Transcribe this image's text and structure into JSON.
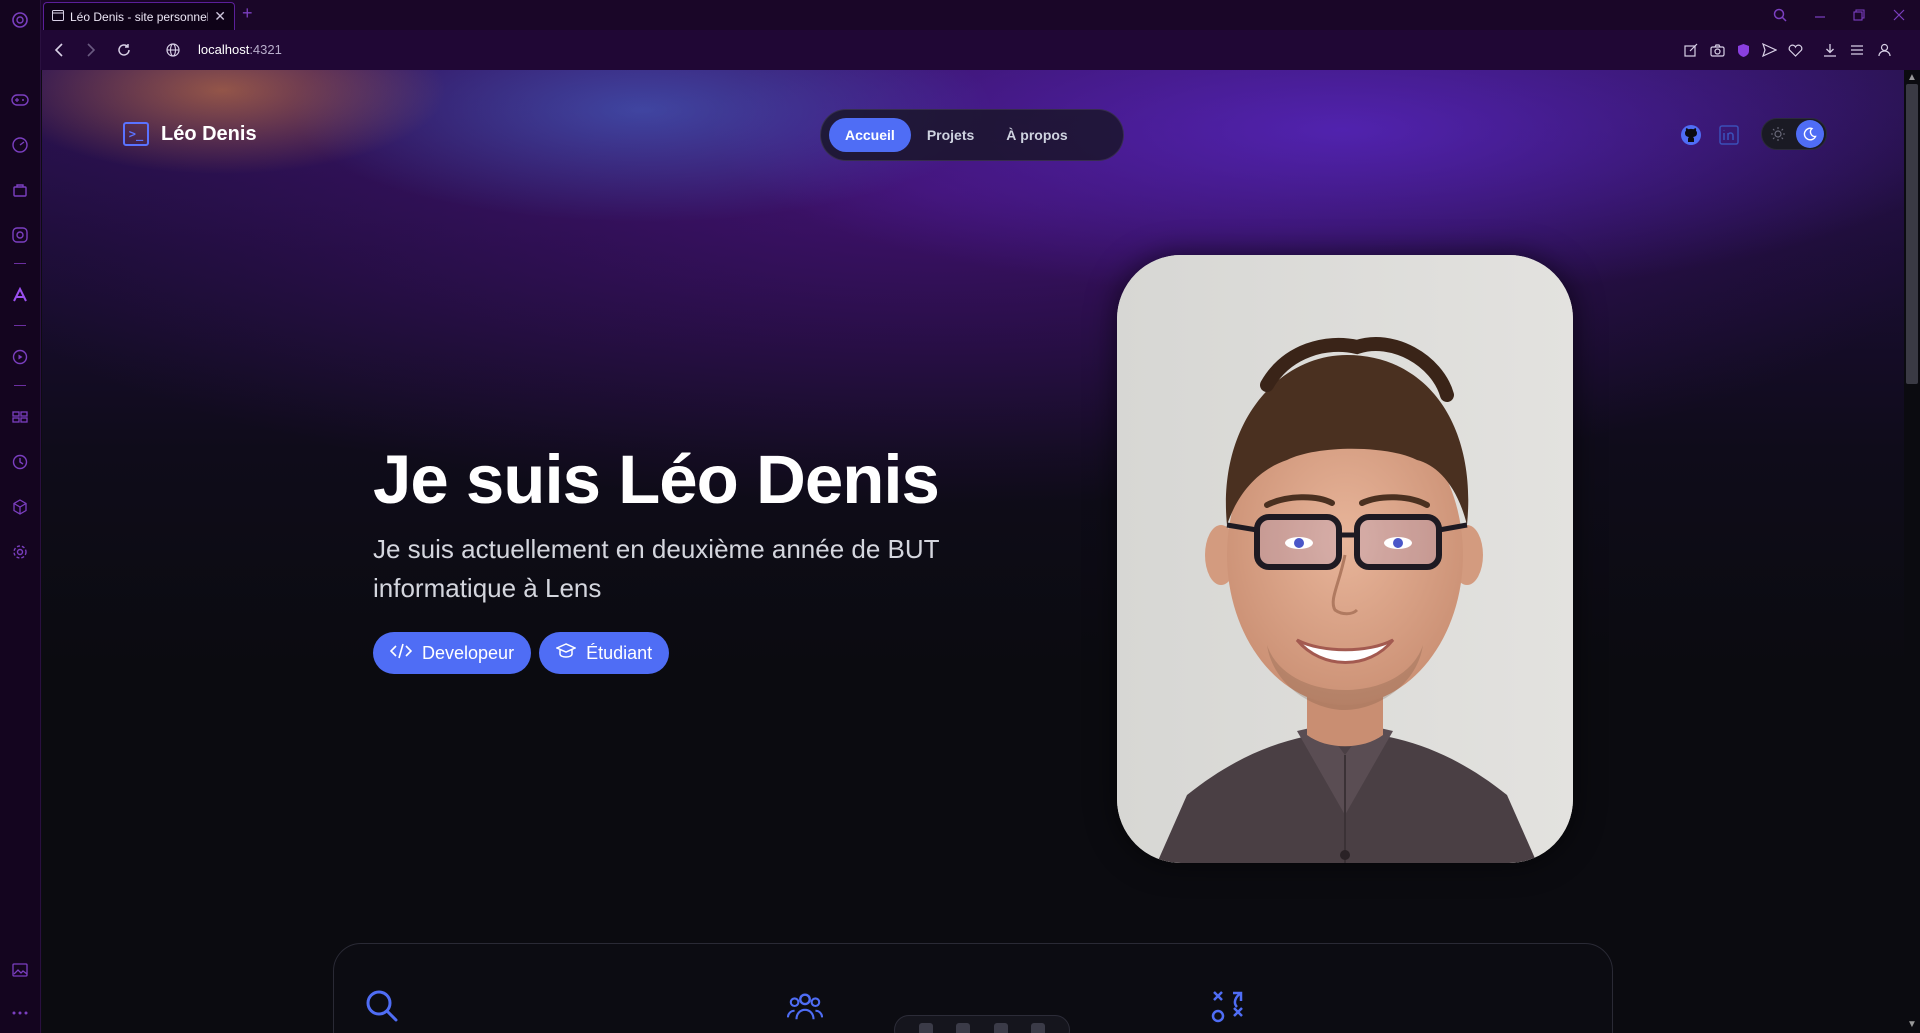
{
  "browser": {
    "tab_title": "Léo Denis - site personnel",
    "new_tab": "+",
    "url_host": "localhost",
    "url_port": ":4321"
  },
  "site": {
    "brand": "Léo Denis",
    "nav": [
      {
        "label": "Accueil",
        "active": true
      },
      {
        "label": "Projets",
        "active": false
      },
      {
        "label": "À propos",
        "active": false
      }
    ],
    "hero": {
      "title": "Je suis Léo Denis",
      "subtitle": "Je suis actuellement en deuxième année de BUT informatique à Lens",
      "badges": [
        "Developeur",
        "Étudiant"
      ]
    }
  },
  "colors": {
    "accent": "#4f6df5",
    "browser_chrome": "#200735",
    "page_bg": "#0b0b10"
  }
}
